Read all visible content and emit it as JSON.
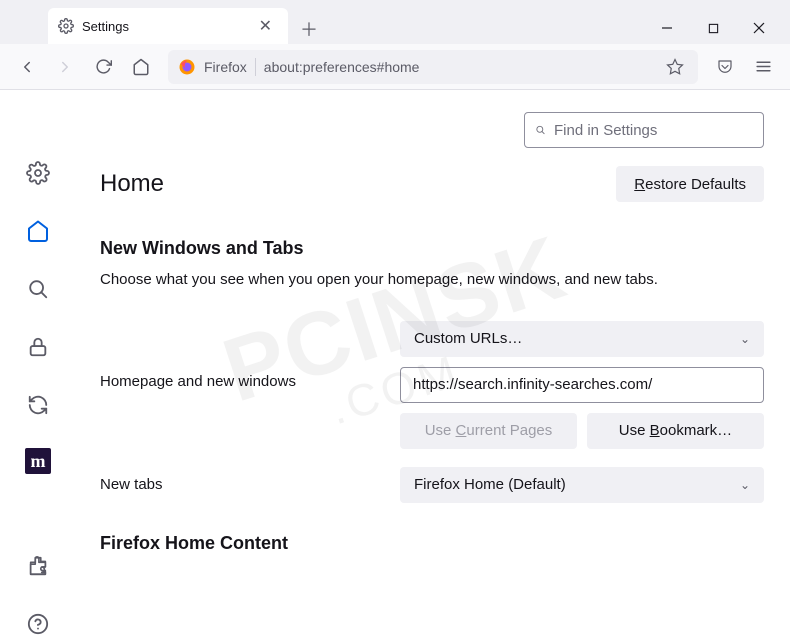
{
  "tab": {
    "title": "Settings"
  },
  "addr": {
    "label": "Firefox",
    "url": "about:preferences#home"
  },
  "search": {
    "placeholder": "Find in Settings"
  },
  "page": {
    "title": "Home",
    "restore": "Restore Defaults",
    "section1_title": "New Windows and Tabs",
    "section1_desc": "Choose what you see when you open your homepage, new windows, and new tabs.",
    "homepage_label": "Homepage and new windows",
    "homepage_select": "Custom URLs…",
    "homepage_value": "https://search.infinity-searches.com/",
    "use_current": "Use Current Pages",
    "use_bookmark": "Use Bookmark…",
    "newtabs_label": "New tabs",
    "newtabs_select": "Firefox Home (Default)",
    "section2_title": "Firefox Home Content"
  },
  "watermark": {
    "big": "PCINSK",
    "small": ".COM"
  }
}
